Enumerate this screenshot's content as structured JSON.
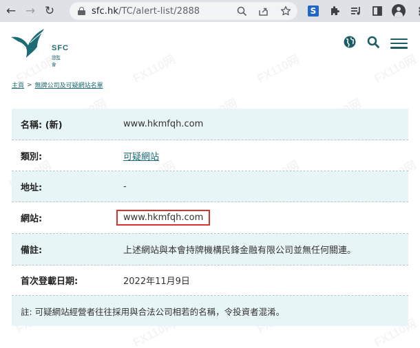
{
  "browser": {
    "url_host": "sfc.hk",
    "url_path": "/TC/alert-list/2888",
    "extension_letter": "S"
  },
  "site": {
    "logo_abbr": "SFC",
    "logo_cn": "證監會"
  },
  "breadcrumb": {
    "home": "主頁",
    "separator": ">",
    "current": "無牌公司及可疑網站名單"
  },
  "details": [
    {
      "label": "名稱: (新)",
      "value": "www.hkmfqh.com"
    },
    {
      "label": "類別:",
      "value": "可疑網站"
    },
    {
      "label": "地址:",
      "value": "-"
    },
    {
      "label": "網站:",
      "value": "www.hkmfqh.com"
    },
    {
      "label": "備註:",
      "value": "上述網站與本會持牌機構民鋒金融有限公司並無任何關連。"
    },
    {
      "label": "首次登載日期:",
      "value": "2022年11月9日"
    }
  ],
  "note": "註: 可疑網站經營者往往採用與合法公司相若的名稱，令投資者混淆。",
  "watermark": "FX110网",
  "colors": {
    "brand": "#1d6b73",
    "row_alt": "#e8f5f6",
    "highlight": "#d9302c"
  }
}
